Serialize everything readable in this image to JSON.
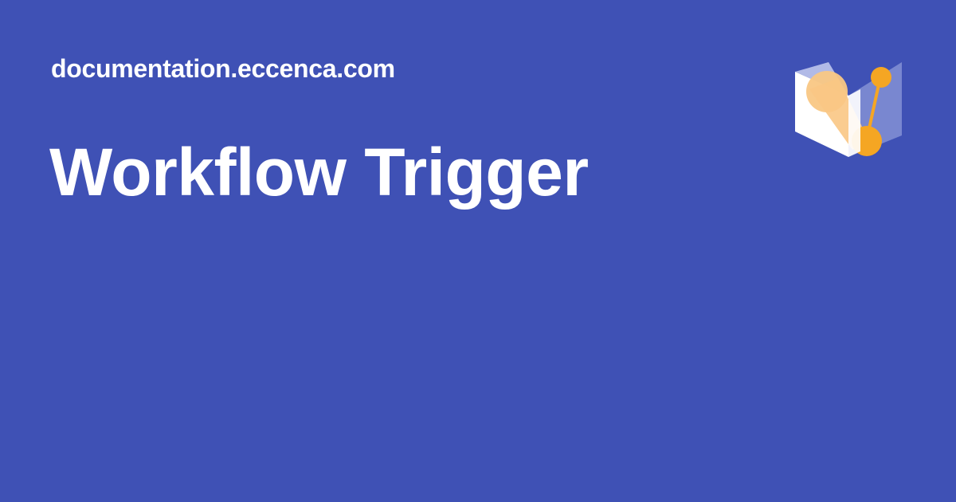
{
  "site": {
    "url_text": "documentation.eccenca.com"
  },
  "page": {
    "title": "Workflow Trigger"
  },
  "logo": {
    "icon": "eccenca-logo-icon"
  },
  "colors": {
    "background": "#3f51b5",
    "text": "#ffffff",
    "logo_orange": "#f5a623",
    "logo_orange_light": "#f9c784",
    "logo_white": "#ffffff",
    "logo_lavender": "#b3bde8"
  }
}
